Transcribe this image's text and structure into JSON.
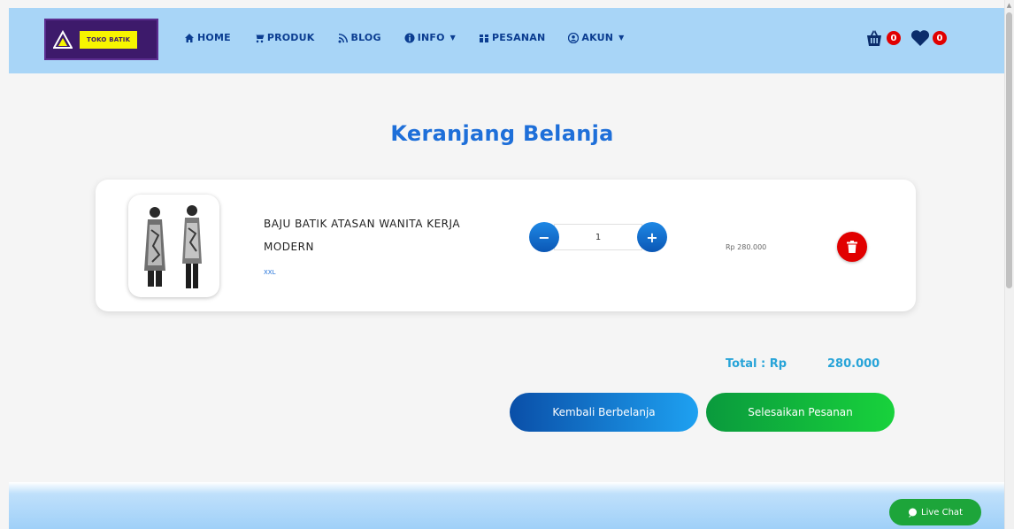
{
  "header": {
    "logo_text": "TOKO BATIK",
    "nav": [
      {
        "label": "HOME",
        "icon": "home-icon"
      },
      {
        "label": "PRODUK",
        "icon": "cart-icon"
      },
      {
        "label": "BLOG",
        "icon": "rss-icon"
      },
      {
        "label": "INFO",
        "icon": "info-icon",
        "dropdown": true
      },
      {
        "label": "PESANAN",
        "icon": "orders-icon"
      },
      {
        "label": "AKUN",
        "icon": "user-icon",
        "dropdown": true
      }
    ],
    "basket_count": "0",
    "wishlist_count": "0"
  },
  "page_title": "Keranjang Belanja",
  "cart": {
    "items": [
      {
        "name": "BAJU BATIK ATASAN WANITA KERJA MODERN",
        "size": "XXL",
        "quantity": "1",
        "price": "Rp 280.000"
      }
    ]
  },
  "totals": {
    "label": "Total : Rp",
    "value": "280.000"
  },
  "buttons": {
    "back": "Kembali Berbelanja",
    "finish": "Selesaikan Pesanan"
  },
  "live_chat": "Live Chat",
  "colors": {
    "header_bg": "#a8d5f7",
    "title": "#1e6fd9",
    "total": "#27a4d8",
    "delete": "#e10000",
    "finish": "#18d23c"
  }
}
